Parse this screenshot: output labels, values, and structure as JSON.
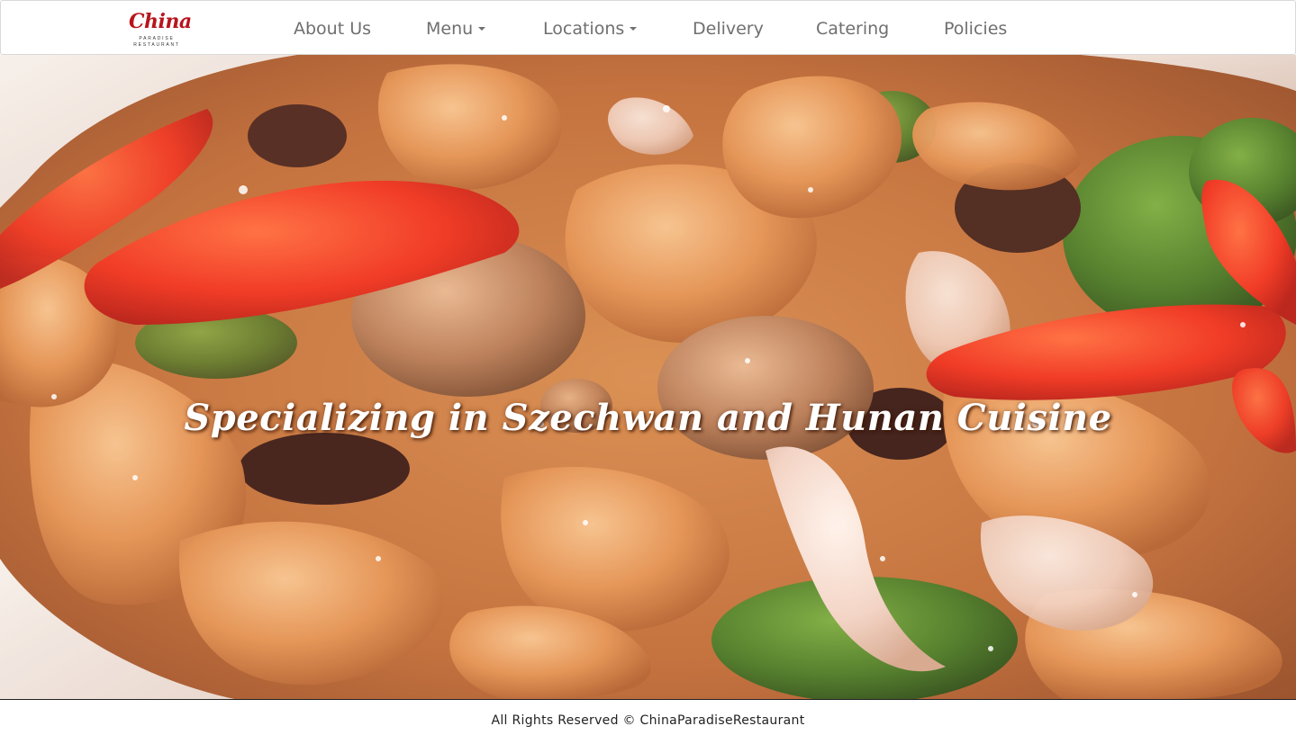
{
  "brand": {
    "logo_script": "China",
    "logo_line1": "PARADISE",
    "logo_line2": "RESTAURANT"
  },
  "nav": {
    "about": "About Us",
    "menu": "Menu",
    "locations": "Locations",
    "delivery": "Delivery",
    "catering": "Catering",
    "policies": "Policies"
  },
  "hero": {
    "title": "Specializing in Szechwan and Hunan Cuisine",
    "image_icon": "food-dish-photo"
  },
  "footer": {
    "text": "All Rights Reserved © ChinaParadiseRestaurant"
  },
  "colors": {
    "nav_text": "#6f6f6f",
    "logo_red": "#b8141c",
    "hero_text": "#ffffff",
    "footer_text": "#222222"
  }
}
